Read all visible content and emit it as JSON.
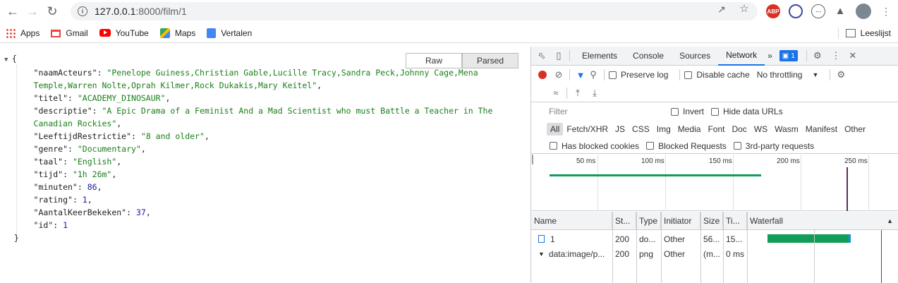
{
  "browser": {
    "url_host": "127.0.0.1",
    "url_rest": ":8000/film/1",
    "bookmarks": [
      {
        "label": "Apps",
        "icon": "apps-grid-icon",
        "color": "#ea4335"
      },
      {
        "label": "Gmail",
        "icon": "gmail-icon",
        "color": "#ea4335"
      },
      {
        "label": "YouTube",
        "icon": "youtube-icon",
        "color": "#ff0000"
      },
      {
        "label": "Maps",
        "icon": "maps-icon",
        "color": "#34a853"
      },
      {
        "label": "Vertalen",
        "icon": "translate-icon",
        "color": "#4285f4"
      }
    ],
    "reading_list": "Leeslijst",
    "abp_label": "ABP"
  },
  "viewer": {
    "raw_label": "Raw",
    "parsed_label": "Parsed",
    "json_lines": [
      {
        "k": "\"naamActeurs\"",
        "v": "\"Penelope Guiness,Christian Gable,Lucille Tracy,Sandra Peck,Johnny Cage,Mena",
        "t": "str",
        "comma": ""
      },
      {
        "k": "",
        "v": "Temple,Warren Nolte,Oprah Kilmer,Rock Dukakis,Mary Keitel\"",
        "t": "str",
        "comma": ","
      },
      {
        "k": "\"titel\"",
        "v": "\"ACADEMY_DINOSAUR\"",
        "t": "str",
        "comma": ","
      },
      {
        "k": "\"descriptie\"",
        "v": "\"A Epic Drama of a Feminist And a Mad Scientist who must Battle a Teacher in The",
        "t": "str",
        "comma": ""
      },
      {
        "k": "",
        "v": "Canadian Rockies\"",
        "t": "str",
        "comma": ","
      },
      {
        "k": "\"LeeftijdRestrictie\"",
        "v": "\"8 and older\"",
        "t": "str",
        "comma": ","
      },
      {
        "k": "\"genre\"",
        "v": "\"Documentary\"",
        "t": "str",
        "comma": ","
      },
      {
        "k": "\"taal\"",
        "v": "\"English\"",
        "t": "str",
        "comma": ","
      },
      {
        "k": "\"tijd\"",
        "v": "\"1h 26m\"",
        "t": "str",
        "comma": ","
      },
      {
        "k": "\"minuten\"",
        "v": "86",
        "t": "num",
        "comma": ","
      },
      {
        "k": "\"rating\"",
        "v": "1",
        "t": "num",
        "comma": ","
      },
      {
        "k": "\"AantalKeerBekeken\"",
        "v": "37",
        "t": "num",
        "comma": ","
      },
      {
        "k": "\"id\"",
        "v": "1",
        "t": "num",
        "comma": ""
      }
    ]
  },
  "devtools": {
    "tabs": [
      "Elements",
      "Console",
      "Sources",
      "Network"
    ],
    "active_tab": "Network",
    "more_label": "»",
    "badge_count": "1",
    "preserve_log": "Preserve log",
    "disable_cache": "Disable cache",
    "throttling": "No throttling",
    "filter_placeholder": "Filter",
    "invert": "Invert",
    "hide_data_urls": "Hide data URLs",
    "types": [
      "All",
      "Fetch/XHR",
      "JS",
      "CSS",
      "Img",
      "Media",
      "Font",
      "Doc",
      "WS",
      "Wasm",
      "Manifest",
      "Other"
    ],
    "active_type": "All",
    "has_blocked_cookies": "Has blocked cookies",
    "blocked_requests": "Blocked Requests",
    "third_party": "3rd-party requests",
    "overview_ticks": [
      "50 ms",
      "100 ms",
      "150 ms",
      "200 ms",
      "250 ms"
    ],
    "columns": [
      "Name",
      "St...",
      "Type",
      "Initiator",
      "Size",
      "Ti...",
      "Waterfall"
    ],
    "rows": [
      {
        "name": "1",
        "status": "200",
        "type": "do...",
        "initiator": "Other",
        "size": "56...",
        "time": "15..."
      },
      {
        "name": "data:image/p...",
        "status": "200",
        "type": "png",
        "initiator": "Other",
        "size": "(m...",
        "time": "0 ms"
      }
    ],
    "accent": "#1a73e8",
    "waterfall_color": "#0f9d58"
  }
}
